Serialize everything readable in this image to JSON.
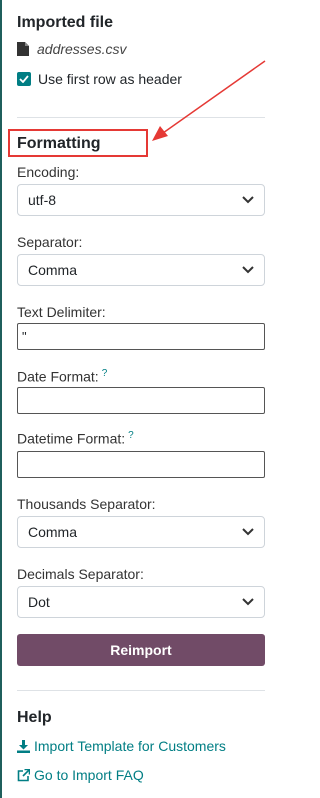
{
  "imported_file": {
    "heading": "Imported file",
    "file_name": "addresses.csv",
    "use_header_label": "Use first row as header",
    "use_header_checked": true
  },
  "formatting": {
    "heading": "Formatting",
    "encoding": {
      "label": "Encoding:",
      "value": "utf-8"
    },
    "separator": {
      "label": "Separator:",
      "value": "Comma"
    },
    "text_delimiter": {
      "label": "Text Delimiter:",
      "value": "\""
    },
    "date_format": {
      "label": "Date Format:",
      "help": "?",
      "value": ""
    },
    "datetime_format": {
      "label": "Datetime Format:",
      "help": "?",
      "value": ""
    },
    "thousands_separator": {
      "label": "Thousands Separator:",
      "value": "Comma"
    },
    "decimals_separator": {
      "label": "Decimals Separator:",
      "value": "Dot"
    }
  },
  "reimport_button": "Reimport",
  "help": {
    "heading": "Help",
    "import_template_link": "Import Template for Customers",
    "faq_link": "Go to Import FAQ"
  },
  "colors": {
    "accent": "#017e84",
    "button": "#714b67",
    "annotation": "#e53935"
  }
}
